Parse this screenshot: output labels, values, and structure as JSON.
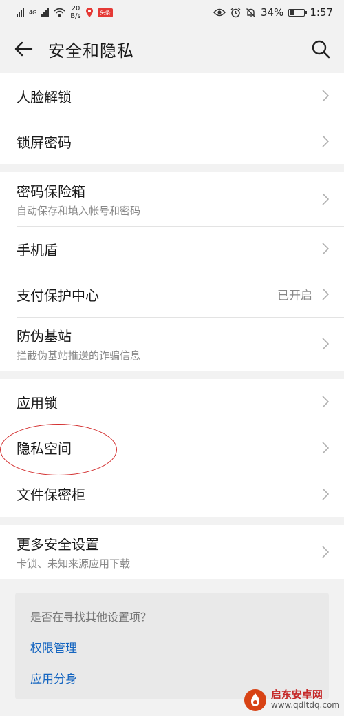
{
  "status_bar": {
    "network_small": "4G",
    "net_speed_top": "20",
    "net_speed_bottom": "B/s",
    "app_badge": "头条",
    "battery_percent": "34%",
    "battery_level": 0.34,
    "time": "1:57"
  },
  "header": {
    "title": "安全和隐私"
  },
  "groups": [
    {
      "items": [
        {
          "title": "人脸解锁"
        },
        {
          "title": "锁屏密码"
        }
      ]
    },
    {
      "items": [
        {
          "title": "密码保险箱",
          "subtitle": "自动保存和填入帐号和密码"
        },
        {
          "title": "手机盾"
        },
        {
          "title": "支付保护中心",
          "value": "已开启"
        },
        {
          "title": "防伪基站",
          "subtitle": "拦截伪基站推送的诈骗信息"
        }
      ]
    },
    {
      "items": [
        {
          "title": "应用锁"
        },
        {
          "title": "隐私空间"
        },
        {
          "title": "文件保密柜"
        }
      ]
    },
    {
      "items": [
        {
          "title": "更多安全设置",
          "subtitle": "卡锁、未知来源应用下载"
        }
      ]
    }
  ],
  "suggestion": {
    "question": "是否在寻找其他设置项？",
    "links": [
      "权限管理",
      "应用分身"
    ]
  },
  "watermark": {
    "name": "启东安卓网",
    "url": "www.qdltdq.com"
  },
  "colors": {
    "link": "#1565c0",
    "annotation_circle": "#d32f2f"
  }
}
